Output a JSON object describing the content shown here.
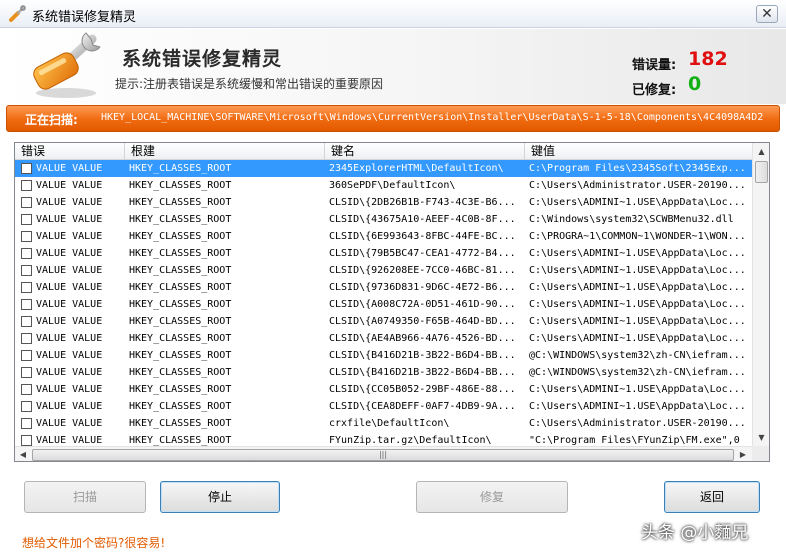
{
  "window": {
    "title": "系统错误修复精灵",
    "close_glyph": "✕"
  },
  "header": {
    "app_title": "系统错误修复精灵",
    "hint": "提示:注册表错误是系统缓慢和常出错误的重要原因",
    "errors_label": "错误量:",
    "errors_count": "182",
    "fixed_label": "已修复:",
    "fixed_count": "0",
    "logo_icon": "wrench-tool-icon",
    "colors": {
      "errors": "#e01010",
      "fixed": "#13b013",
      "scanbar": "#f06a10"
    }
  },
  "scan": {
    "label": "正在扫描:",
    "path": "HKEY_LOCAL_MACHINE\\SOFTWARE\\Microsoft\\Windows\\CurrentVersion\\Installer\\UserData\\S-1-5-18\\Components\\4C4098A4D2"
  },
  "list": {
    "columns": [
      "错误",
      "根建",
      "键名",
      "键值"
    ],
    "rows": [
      {
        "error": "VALUE VALUE",
        "root": "HKEY_CLASSES_ROOT",
        "key": "2345ExplorerHTML\\DefaultIcon\\",
        "value": "C:\\Program Files\\2345Soft\\2345Exp..."
      },
      {
        "error": "VALUE VALUE",
        "root": "HKEY_CLASSES_ROOT",
        "key": "360SePDF\\DefaultIcon\\",
        "value": "C:\\Users\\Administrator.USER-20190..."
      },
      {
        "error": "VALUE VALUE",
        "root": "HKEY_CLASSES_ROOT",
        "key": "CLSID\\{2DB26B1B-F743-4C3E-B6...",
        "value": "C:\\Users\\ADMINI~1.USE\\AppData\\Loc..."
      },
      {
        "error": "VALUE VALUE",
        "root": "HKEY_CLASSES_ROOT",
        "key": "CLSID\\{43675A10-AEEF-4C0B-8F...",
        "value": "C:\\Windows\\system32\\SCWBMenu32.dll"
      },
      {
        "error": "VALUE VALUE",
        "root": "HKEY_CLASSES_ROOT",
        "key": "CLSID\\{6E993643-8FBC-44FE-BC...",
        "value": "C:\\PROGRA~1\\COMMON~1\\WONDER~1\\WON..."
      },
      {
        "error": "VALUE VALUE",
        "root": "HKEY_CLASSES_ROOT",
        "key": "CLSID\\{79B5BC47-CEA1-4772-B4...",
        "value": "C:\\Users\\ADMINI~1.USE\\AppData\\Loc..."
      },
      {
        "error": "VALUE VALUE",
        "root": "HKEY_CLASSES_ROOT",
        "key": "CLSID\\{926208EE-7CC0-46BC-81...",
        "value": "C:\\Users\\ADMINI~1.USE\\AppData\\Loc..."
      },
      {
        "error": "VALUE VALUE",
        "root": "HKEY_CLASSES_ROOT",
        "key": "CLSID\\{9736D831-9D6C-4E72-B6...",
        "value": "C:\\Users\\ADMINI~1.USE\\AppData\\Loc..."
      },
      {
        "error": "VALUE VALUE",
        "root": "HKEY_CLASSES_ROOT",
        "key": "CLSID\\{A008C72A-0D51-461D-90...",
        "value": "C:\\Users\\ADMINI~1.USE\\AppData\\Loc..."
      },
      {
        "error": "VALUE VALUE",
        "root": "HKEY_CLASSES_ROOT",
        "key": "CLSID\\{A0749350-F65B-464D-BD...",
        "value": "C:\\Users\\ADMINI~1.USE\\AppData\\Loc..."
      },
      {
        "error": "VALUE VALUE",
        "root": "HKEY_CLASSES_ROOT",
        "key": "CLSID\\{AE4AB966-4A76-4526-BD...",
        "value": "C:\\Users\\ADMINI~1.USE\\AppData\\Loc..."
      },
      {
        "error": "VALUE VALUE",
        "root": "HKEY_CLASSES_ROOT",
        "key": "CLSID\\{B416D21B-3B22-B6D4-BB...",
        "value": "@C:\\WINDOWS\\system32\\zh-CN\\iefram..."
      },
      {
        "error": "VALUE VALUE",
        "root": "HKEY_CLASSES_ROOT",
        "key": "CLSID\\{B416D21B-3B22-B6D4-BB...",
        "value": "@C:\\WINDOWS\\system32\\zh-CN\\iefram..."
      },
      {
        "error": "VALUE VALUE",
        "root": "HKEY_CLASSES_ROOT",
        "key": "CLSID\\{CC05B052-29BF-486E-88...",
        "value": "C:\\Users\\ADMINI~1.USE\\AppData\\Loc..."
      },
      {
        "error": "VALUE VALUE",
        "root": "HKEY_CLASSES_ROOT",
        "key": "CLSID\\{CEA8DEFF-0AF7-4DB9-9A...",
        "value": "C:\\Users\\ADMINI~1.USE\\AppData\\Loc..."
      },
      {
        "error": "VALUE VALUE",
        "root": "HKEY_CLASSES_ROOT",
        "key": "crxfile\\DefaultIcon\\",
        "value": "C:\\Users\\Administrator.USER-20190..."
      },
      {
        "error": "VALUE VALUE",
        "root": "HKEY_CLASSES_ROOT",
        "key": "FYunZip.tar.gz\\DefaultIcon\\",
        "value": "\"C:\\Program Files\\FYunZip\\FM.exe\",0"
      }
    ],
    "selected_row": 0,
    "scroll_up": "▲",
    "scroll_down": "▼",
    "scroll_left": "◀",
    "scroll_right": "▶",
    "grip": "|||"
  },
  "buttons": {
    "scan": "扫描",
    "stop": "停止",
    "repair": "修复",
    "back": "返回"
  },
  "footer": {
    "link": "想给文件加个密码?很容易!",
    "watermark": "头条 @小麵兄"
  }
}
